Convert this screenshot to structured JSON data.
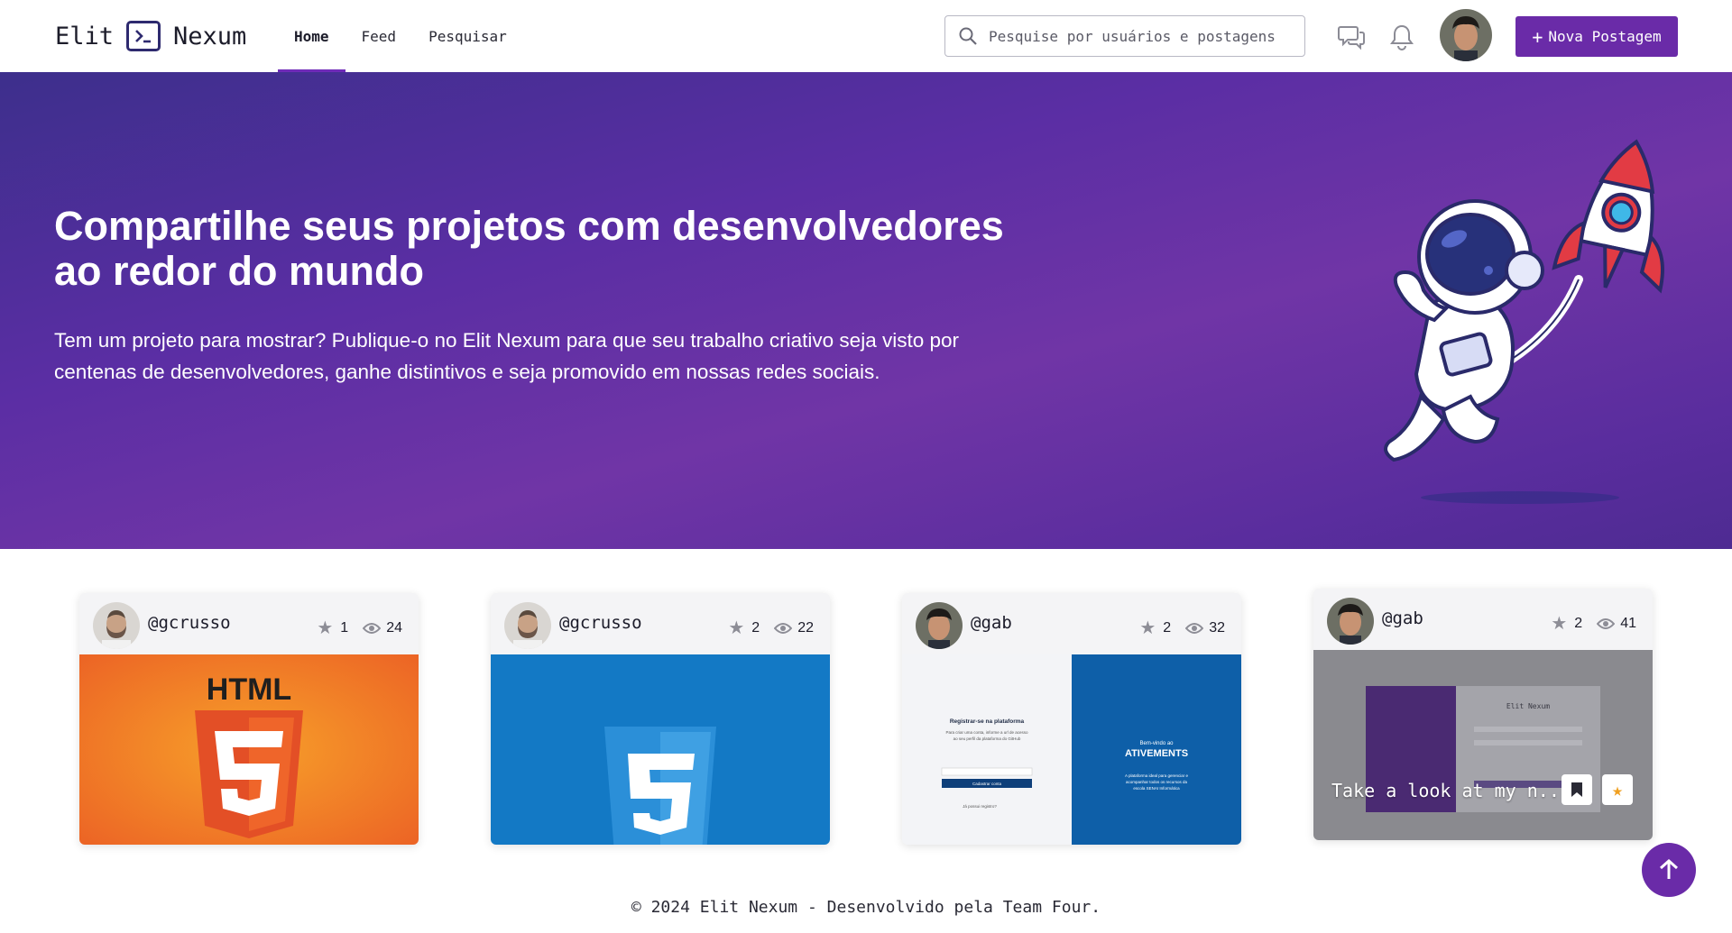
{
  "brand": {
    "left": "Elit",
    "right": "Nexum"
  },
  "nav": {
    "links": [
      "Home",
      "Feed",
      "Pesquisar"
    ],
    "active": "Home"
  },
  "search": {
    "placeholder": "Pesquise por usuários e postagens"
  },
  "icons": {
    "chat": "chat-bubbles-icon",
    "notifications": "bell-icon",
    "search": "search-icon"
  },
  "new_post": {
    "label": "Nova Postagem"
  },
  "hero": {
    "title": "Compartilhe seus projetos com desenvolvedores ao redor do mundo",
    "subtitle": "Tem um projeto para mostrar? Publique-o no Elit Nexum para que seu trabalho criativo seja visto por centenas de desenvolvedores, ganhe distintivos e seja promovido em nossas redes sociais."
  },
  "cards": [
    {
      "user": "@gcrusso",
      "stars": "1",
      "views": "24",
      "thumb": "HTML"
    },
    {
      "user": "@gcrusso",
      "stars": "2",
      "views": "22",
      "thumb": "CSS3"
    },
    {
      "user": "@gab",
      "stars": "2",
      "views": "32",
      "thumb": "ATIVEMENTS"
    },
    {
      "user": "@gab",
      "stars": "2",
      "views": "41",
      "thumb": "Elit Nexum",
      "overlay": "Take a look at my n..."
    }
  ],
  "thumb_text": {
    "register_title": "Registrar-se na plataforma",
    "register_text": "Para criar uma conta, informe a url de acesso ao seu perfil da plataforma do GitHub",
    "register_btn": "Cadastrar conta",
    "welcome": "Bem-vindo ao",
    "welcome_text": "A plataforma ideal para gerenciar e acompanhar todos os recursos da escola SENAI Informática",
    "already": "Já possui registro?"
  },
  "colors": {
    "primary": "#6a2ba8",
    "hero_start": "#3d2f8c",
    "hero_end": "#7035a6"
  },
  "footer": {
    "text": "© 2024 Elit Nexum - Desenvolvido pela Team Four."
  }
}
